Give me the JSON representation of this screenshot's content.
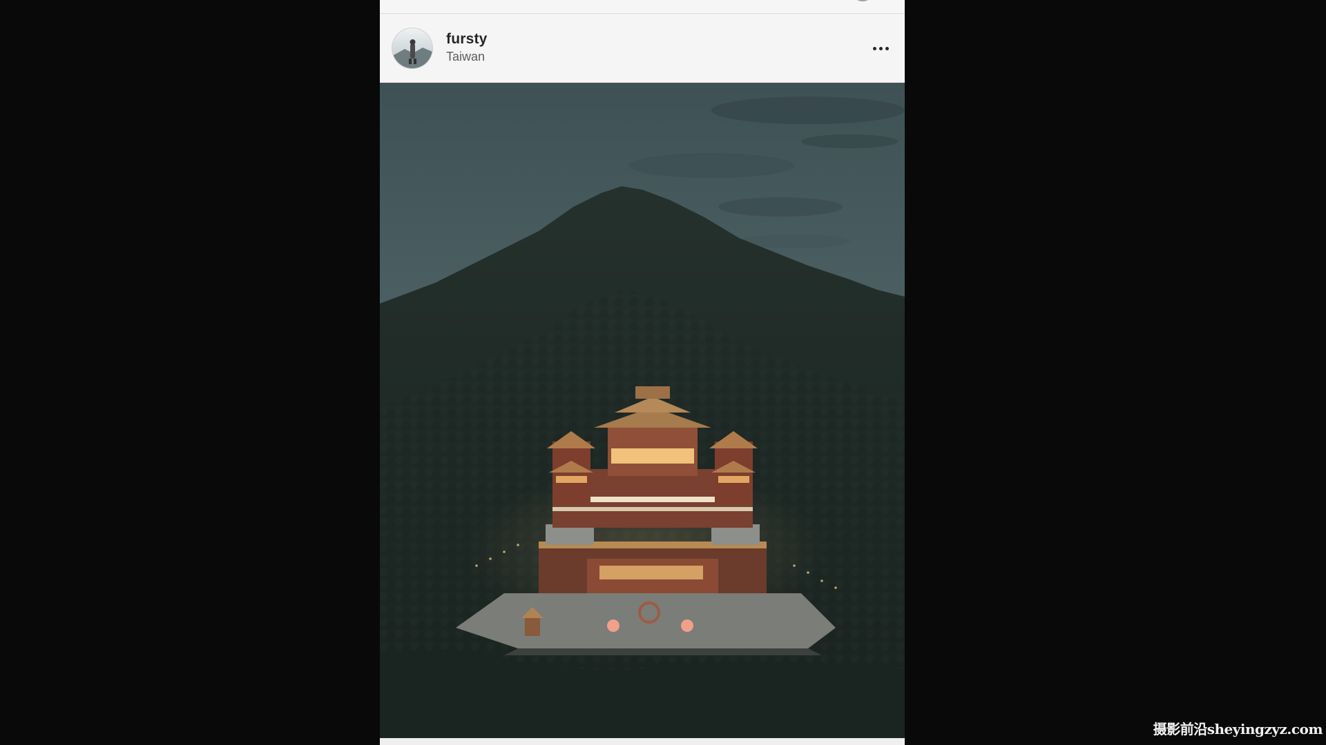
{
  "post": {
    "username": "fursty",
    "location": "Taiwan",
    "avatar_icon": "profile-avatar",
    "more_icon": "more-horizontal-icon",
    "photo_subject": "temple-on-mountain-photo"
  },
  "watermark": {
    "text": "摄影前沿sheyingzyz.com"
  },
  "colors": {
    "sky": "#4a5d61",
    "mountain": "#1f2a26",
    "temple_lights": "#e8b06a",
    "page_bg": "#090909"
  }
}
